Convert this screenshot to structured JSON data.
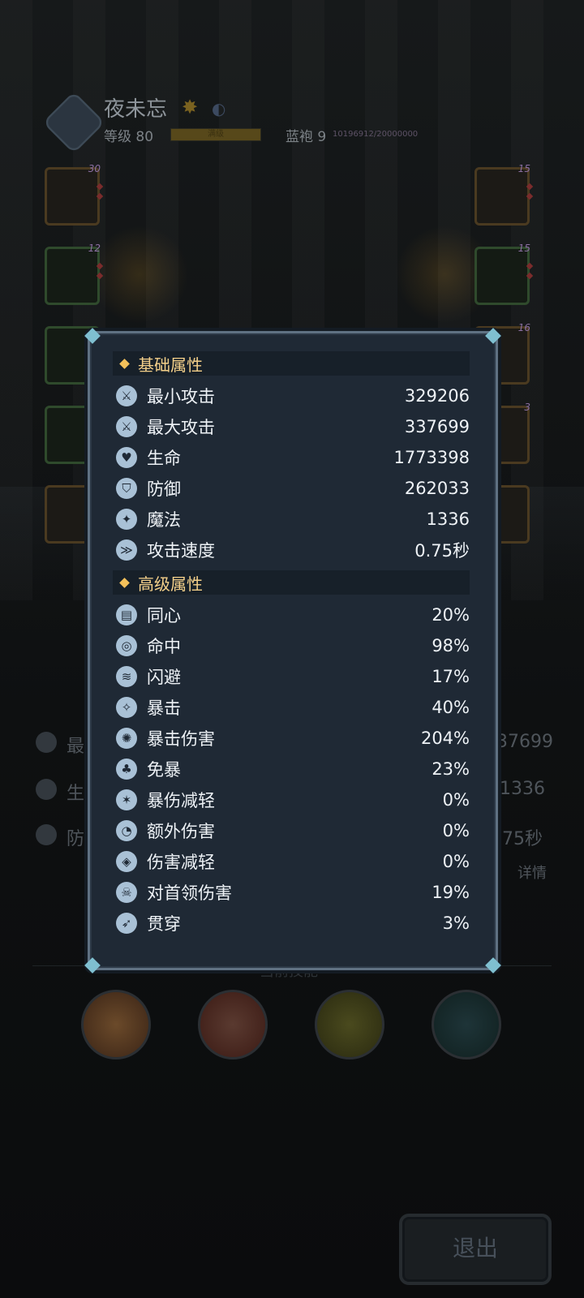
{
  "player": {
    "name": "夜未忘",
    "level_label": "等级 80",
    "level_bar_text": "满级",
    "rank_label": "蓝袍 9",
    "exp_text": "10196912/20000000"
  },
  "equipment": {
    "left_levels": [
      "30",
      "12",
      "",
      "",
      ""
    ],
    "right_levels": [
      "15",
      "15",
      "16",
      "3",
      ""
    ]
  },
  "background_stats": {
    "row1_label": "最",
    "row1_value": "37699",
    "row2_label": "生",
    "row2_value": "1336",
    "row3_label": "防",
    "row3_value": ".75秒",
    "detail_link": "详情"
  },
  "current_skill_label": "当前技能",
  "skills": [
    "fire-burst-icon",
    "crossed-axes-icon",
    "bubbles-icon",
    "shield-drop-icon"
  ],
  "exit_button": "退出",
  "panel": {
    "basic": {
      "title": "基础属性",
      "rows": [
        {
          "label": "最小攻击",
          "value": "329206",
          "icon": "sword-icon"
        },
        {
          "label": "最大攻击",
          "value": "337699",
          "icon": "sword-icon"
        },
        {
          "label": "生命",
          "value": "1773398",
          "icon": "heart-icon"
        },
        {
          "label": "防御",
          "value": "262033",
          "icon": "shield-icon"
        },
        {
          "label": "魔法",
          "value": "1336",
          "icon": "magic-icon"
        },
        {
          "label": "攻击速度",
          "value": "0.75秒",
          "icon": "speed-icon"
        }
      ]
    },
    "advanced": {
      "title": "高级属性",
      "rows": [
        {
          "label": "同心",
          "value": "20%",
          "icon": "scroll-icon"
        },
        {
          "label": "命中",
          "value": "98%",
          "icon": "target-icon"
        },
        {
          "label": "闪避",
          "value": "17%",
          "icon": "dodge-icon"
        },
        {
          "label": "暴击",
          "value": "40%",
          "icon": "crit-icon"
        },
        {
          "label": "暴击伤害",
          "value": "204%",
          "icon": "burst-icon"
        },
        {
          "label": "免暴",
          "value": "23%",
          "icon": "mushroom-icon"
        },
        {
          "label": "暴伤减轻",
          "value": "0%",
          "icon": "reduce-crit-icon"
        },
        {
          "label": "额外伤害",
          "value": "0%",
          "icon": "extra-damage-icon"
        },
        {
          "label": "伤害减轻",
          "value": "0%",
          "icon": "armor-icon"
        },
        {
          "label": "对首领伤害",
          "value": "19%",
          "icon": "boss-icon"
        },
        {
          "label": "贯穿",
          "value": "3%",
          "icon": "pierce-icon"
        }
      ]
    }
  },
  "colors": {
    "panel_bg": "#1f2935",
    "section_title": "#f4d08a",
    "diamond": "#f4c15a",
    "icon_bg": "#a9c1d6"
  }
}
